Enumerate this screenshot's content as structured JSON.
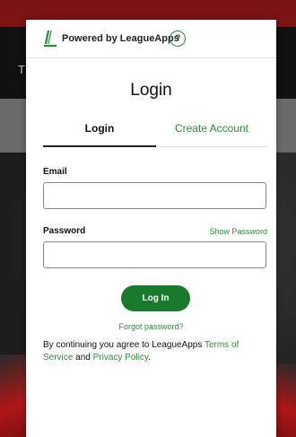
{
  "powered_by": {
    "text": "Powered by LeagueApps",
    "help_icon": "?"
  },
  "title": "Login",
  "tabs": [
    {
      "label": "Login",
      "active": true
    },
    {
      "label": "Create Account",
      "active": false
    }
  ],
  "form": {
    "email_label": "Email",
    "email_value": "",
    "password_label": "Password",
    "password_value": "",
    "show_password": "Show Password",
    "submit_label": "Log In",
    "forgot": "Forgot password?"
  },
  "terms": {
    "prefix": "By continuing you agree to LeagueApps ",
    "tos": "Terms of Service",
    "middle": " and ",
    "privacy": "Privacy Policy",
    "suffix": "."
  },
  "background": {
    "header_letter": "T"
  },
  "colors": {
    "accent": "#2e8b3a",
    "button": "#197a2e",
    "top_bar": "#7d1414"
  }
}
